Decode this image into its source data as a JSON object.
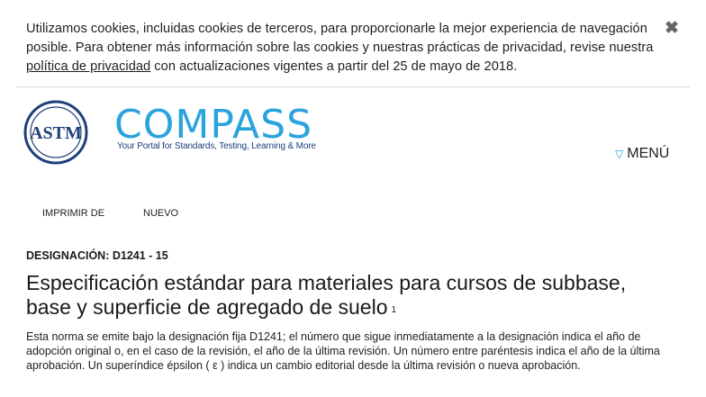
{
  "cookie_banner": {
    "text_before": "Utilizamos cookies, incluidas cookies de terceros, para proporcionarle la mejor experiencia de navegación posible. Para obtener más información sobre las cookies y nuestras prácticas de privacidad, revise nuestra ",
    "link_label": "política de privacidad",
    "text_after": " con actualizaciones vigentes a partir del 25 de mayo de 2018.",
    "close_icon": "✖"
  },
  "header": {
    "logo_letters": "ASTM",
    "brand_name": "COMPASS",
    "tagline": "Your Portal for Standards, Testing, Learning & More",
    "menu_icon": "▽",
    "menu_label": "MENÚ",
    "colors": {
      "brand_blue": "#2aa3dc",
      "navy": "#1e3f7a"
    }
  },
  "tabs": [
    "IMPRIMIR DE",
    "NUEVO"
  ],
  "document": {
    "designation": "DESIGNACIÓN: D1241 - 15",
    "title": "Especificación estándar para materiales para cursos de subbase, base y superficie de agregado de suelo",
    "title_sup": "1",
    "description": "Esta norma se emite bajo la designación fija D1241; el número que sigue inmediatamente a la designación indica el año de adopción original o, en el caso de la revisión, el año de la última revisión. Un número entre paréntesis indica el año de la última aprobación. Un superíndice épsilon ( ε ) indica un cambio editorial desde la última revisión o nueva aprobación."
  }
}
